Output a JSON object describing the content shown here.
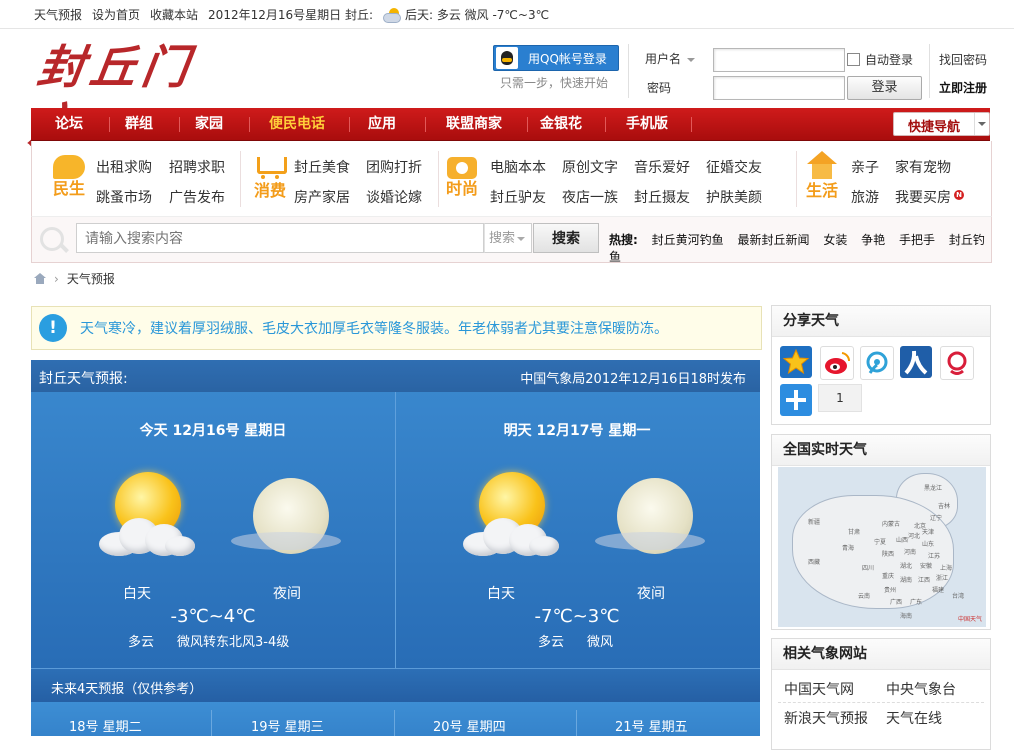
{
  "topbar": {
    "items": [
      "天气预报",
      "设为首页",
      "收藏本站",
      "2012年12月16号星期日 封丘:"
    ],
    "weather": "后天: 多云  微风  -7℃~3℃"
  },
  "header": {
    "logo": "封丘门户",
    "qq_login": "用QQ帐号登录",
    "qq_sub": "只需一步，快速开始",
    "username_label": "用户名",
    "password_label": "密码",
    "auto_login": "自动登录",
    "login_btn": "登录",
    "forgot": "找回密码",
    "register": "立即注册"
  },
  "nav": {
    "items": [
      "论坛",
      "群组",
      "家园",
      "便民电话",
      "应用",
      "联盟商家",
      "金银花",
      "手机版"
    ],
    "active_index": 3,
    "quick": "快捷导航"
  },
  "categories": [
    {
      "name": "民生",
      "icon": "speech-bubble-icon",
      "links": [
        "出租求购",
        "招聘求职",
        "跳蚤市场",
        "广告发布"
      ]
    },
    {
      "name": "消费",
      "icon": "shopping-cart-icon",
      "links": [
        "封丘美食",
        "团购打折",
        "房产家居",
        "谈婚论嫁"
      ]
    },
    {
      "name": "时尚",
      "icon": "camera-icon",
      "links": [
        "电脑本本",
        "原创文字",
        "音乐爱好",
        "征婚交友",
        "封丘驴友",
        "夜店一族",
        "封丘摄友",
        "护肤美颜"
      ]
    },
    {
      "name": "生活",
      "icon": "house-icon",
      "links": [
        "亲子",
        "家有宠物",
        "旅游",
        "我要买房"
      ]
    }
  ],
  "new_badge": "N",
  "search": {
    "placeholder": "请输入搜索内容",
    "select": "搜索",
    "button": "搜索",
    "hot_label": "热搜:",
    "hot": [
      "封丘黄河钓鱼",
      "最新封丘新闻",
      "女装",
      "争艳",
      "手把手",
      "封丘钓鱼"
    ]
  },
  "breadcrumb": {
    "current": "天气预报",
    "sep": "›"
  },
  "alert": {
    "icon": "!",
    "text": "天气寒冷，建议着厚羽绒服、毛皮大衣加厚毛衣等隆冬服装。年老体弱者尤其要注意保暖防冻。"
  },
  "forecast": {
    "title": "封丘天气预报:",
    "source": "中国气象局2012年12月16日18时发布",
    "days": [
      {
        "title": "今天  12月16号  星期日",
        "day_label": "白天",
        "night_label": "夜间",
        "temp": "-3℃~4℃",
        "cond_day": "多云",
        "cond_night": "微风转东北风3-4级"
      },
      {
        "title": "明天  12月17号  星期一",
        "day_label": "白天",
        "night_label": "夜间",
        "temp": "-7℃~3℃",
        "cond_day": "多云",
        "cond_night": "微风"
      }
    ],
    "future_title": "未来4天预报（仅供参考）",
    "future": [
      "18号  星期二",
      "19号  星期三",
      "20号  星期四",
      "21号  星期五"
    ]
  },
  "sidebar": {
    "share_title": "分享天气",
    "share_icons": [
      "qzone-star-icon",
      "weibo-icon",
      "tencent-weibo-icon",
      "renren-icon",
      "kaixin-icon",
      "more-plus-icon"
    ],
    "share_count": "1",
    "realtime_title": "全国实时天气",
    "map_labels": [
      "黑龙江",
      "吉林",
      "辽宁",
      "内蒙古",
      "北京",
      "天津",
      "河北",
      "山西",
      "山东",
      "新疆",
      "甘肃",
      "青海",
      "宁夏",
      "陕西",
      "河南",
      "江苏",
      "西藏",
      "四川",
      "湖北",
      "安徽",
      "上海",
      "重庆",
      "湖南",
      "江西",
      "浙江",
      "贵州",
      "福建",
      "云南",
      "广西",
      "广东",
      "台湾",
      "海南"
    ],
    "map_badge": "中国天气",
    "related_title": "相关气象网站",
    "related": [
      "中国天气网",
      "中央气象台",
      "新浪天气预报",
      "天气在线"
    ]
  }
}
